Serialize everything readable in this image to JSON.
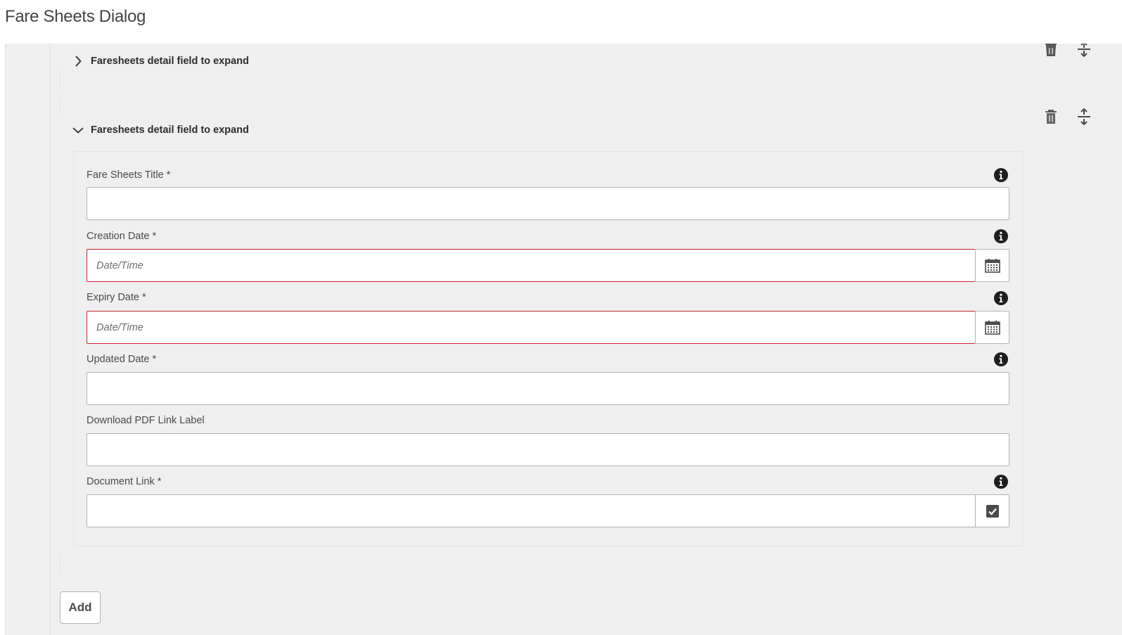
{
  "dialog": {
    "title": "Fare Sheets Dialog"
  },
  "items": [
    {
      "label": "Faresheets detail field to expand",
      "expanded": false
    },
    {
      "label": "Faresheets detail field to expand",
      "expanded": true
    }
  ],
  "fields": {
    "title": {
      "label": "Fare Sheets Title *",
      "value": ""
    },
    "creation_date": {
      "label": "Creation Date *",
      "placeholder": "Date/Time",
      "value": ""
    },
    "expiry_date": {
      "label": "Expiry Date *",
      "placeholder": "Date/Time",
      "value": ""
    },
    "updated_date": {
      "label": "Updated Date *",
      "value": ""
    },
    "download_pdf_label": {
      "label": "Download PDF Link Label",
      "value": ""
    },
    "document_link": {
      "label": "Document Link *",
      "value": ""
    }
  },
  "add_button": {
    "label": "Add"
  },
  "icons": {
    "info": "info-icon",
    "calendar": "calendar-icon",
    "delete": "trash-icon",
    "reorder": "reorder-icon",
    "chevron_collapsed": "chevron-right-icon",
    "chevron_expanded": "chevron-down-icon",
    "browse": "checkbox-icon"
  },
  "colors": {
    "invalid_border": "#c9252d",
    "panel_bg": "#efefef"
  }
}
